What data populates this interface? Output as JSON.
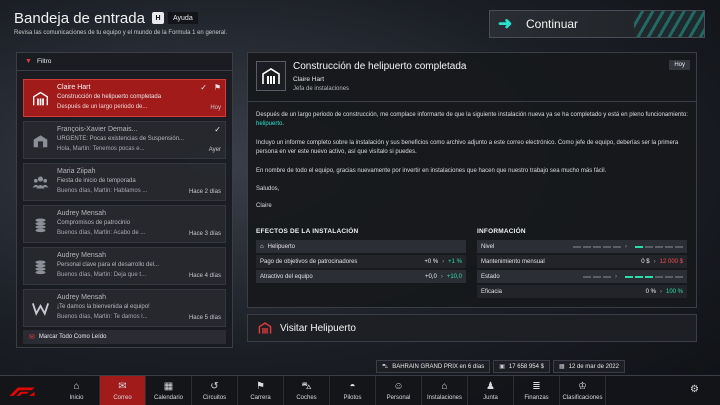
{
  "header": {
    "title": "Bandeja de entrada",
    "help_key": "H",
    "help_label": "Ayuda",
    "subtitle": "Revisa las comunicaciones de tu equipo y el mundo de la Formula 1 en general."
  },
  "continue_label": "Continuar",
  "filter_label": "Filtro",
  "messages": [
    {
      "name": "Claire Hart",
      "subject": "Construcción de helipuerto completada",
      "preview": "Después de un largo periodo de...",
      "date": "Hoy",
      "icon": "building-icon"
    },
    {
      "name": "François-Xavier Demais...",
      "subject": "URGENTE: Pocas existencias de Suspensión...",
      "preview": "Hola, Martin: Tenemos pocas e...",
      "date": "Ayer",
      "icon": "factory-icon"
    },
    {
      "name": "Maria Ziipah",
      "subject": "Fiesta de inicio de temporada",
      "preview": "Buenos días, Martin: Hablamos ...",
      "date": "Hace 2 días",
      "icon": "people-icon"
    },
    {
      "name": "Audrey Mensah",
      "subject": "Compromisos de patrocinio",
      "preview": "Buenos días, Martin: Acabo de ...",
      "date": "Hace 3 días",
      "icon": "coins-icon"
    },
    {
      "name": "Audrey Mensah",
      "subject": "Personal clave para el desarrollo del...",
      "preview": "Buenos días, Martin: Deja que t...",
      "date": "Hace 4 días",
      "icon": "coins-icon"
    },
    {
      "name": "Audrey Mensah",
      "subject": "¡Te damos la bienvenida al equipo!",
      "preview": "Buenos días, Martin: Te damos l...",
      "date": "Hace 5 días",
      "icon": "williams-logo-icon"
    }
  ],
  "mark_all_label": "Marcar Todo Como Leído",
  "detail": {
    "title": "Construcción de helipuerto completada",
    "from": "Claire Hart",
    "role": "Jefa de instalaciones",
    "date": "Hoy",
    "p1_a": "Después de un largo periodo de construcción, me complace informarte de que la siguiente instalación nueva ya se ha completado y está en pleno funcionamiento: ",
    "p1_link": "helipuerto",
    "p1_b": ".",
    "p2": "Incluyo un informe completo sobre la instalación y sus beneficios como archivo adjunto a este correo electrónico. Como jefe de equipo, deberías ser la primera persona en ver este nuevo activo, así que visítalo si puedes.",
    "p3": "En nombre de todo el equipo, gracias nuevamente por invertir en instalaciones que hacen que nuestro trabajo sea mucho más fácil.",
    "p4": "Saludos,",
    "p5": "Claire"
  },
  "effects": {
    "heading": "EFECTOS DE LA INSTALACIÓN",
    "facility": "Helipuerto",
    "rows": [
      {
        "label": "Pago de objetivos de patrocinadores",
        "from": "+0 %",
        "to": "+1 %"
      },
      {
        "label": "Atractivo del equipo",
        "from": "+0,0",
        "to": "+10,0"
      }
    ]
  },
  "info": {
    "heading": "INFORMACIÓN",
    "level_label": "Nivel",
    "level": {
      "current": 0,
      "new": 1,
      "max": 5
    },
    "maintenance_label": "Mantenimiento mensual",
    "maintenance_from": "0 $",
    "maintenance_to": "12 000 $",
    "state_label": "Estado",
    "state": {
      "filled": 3,
      "max": 6
    },
    "efficiency_label": "Eficacia",
    "efficiency_from": "0 %",
    "efficiency_to": "100 %"
  },
  "visit_label": "Visitar Helipuerto",
  "status": {
    "race": "BAHRAIN GRAND PRIX en 6 días",
    "budget": "17 658 954 $",
    "date": "12 de mar de 2022"
  },
  "nav": [
    {
      "label": "Inicio",
      "icon": "home-icon",
      "glyph": "⌂"
    },
    {
      "label": "Correo",
      "icon": "mail-icon",
      "glyph": "✉"
    },
    {
      "label": "Calendario",
      "icon": "calendar-icon",
      "glyph": "▦"
    },
    {
      "label": "Circuitos",
      "icon": "circuit-icon",
      "glyph": "↺"
    },
    {
      "label": "Carrera",
      "icon": "race-flag-icon",
      "glyph": "⚑"
    },
    {
      "label": "Coches",
      "icon": "car-icon",
      "glyph": "⛍"
    },
    {
      "label": "Pilotos",
      "icon": "helmet-icon",
      "glyph": "◓"
    },
    {
      "label": "Personal",
      "icon": "person-icon",
      "glyph": "☺"
    },
    {
      "label": "Instalaciones",
      "icon": "building-icon",
      "glyph": "⌂"
    },
    {
      "label": "Junta",
      "icon": "board-icon",
      "glyph": "♟"
    },
    {
      "label": "Finanzas",
      "icon": "finance-icon",
      "glyph": "≣"
    },
    {
      "label": "Clasificaciones",
      "icon": "trophy-icon",
      "glyph": "♔"
    }
  ],
  "colors": {
    "accent": "#27e0d0",
    "selected": "#a11b1b",
    "positive": "#27e0a6",
    "negative": "#ff4b4b"
  }
}
